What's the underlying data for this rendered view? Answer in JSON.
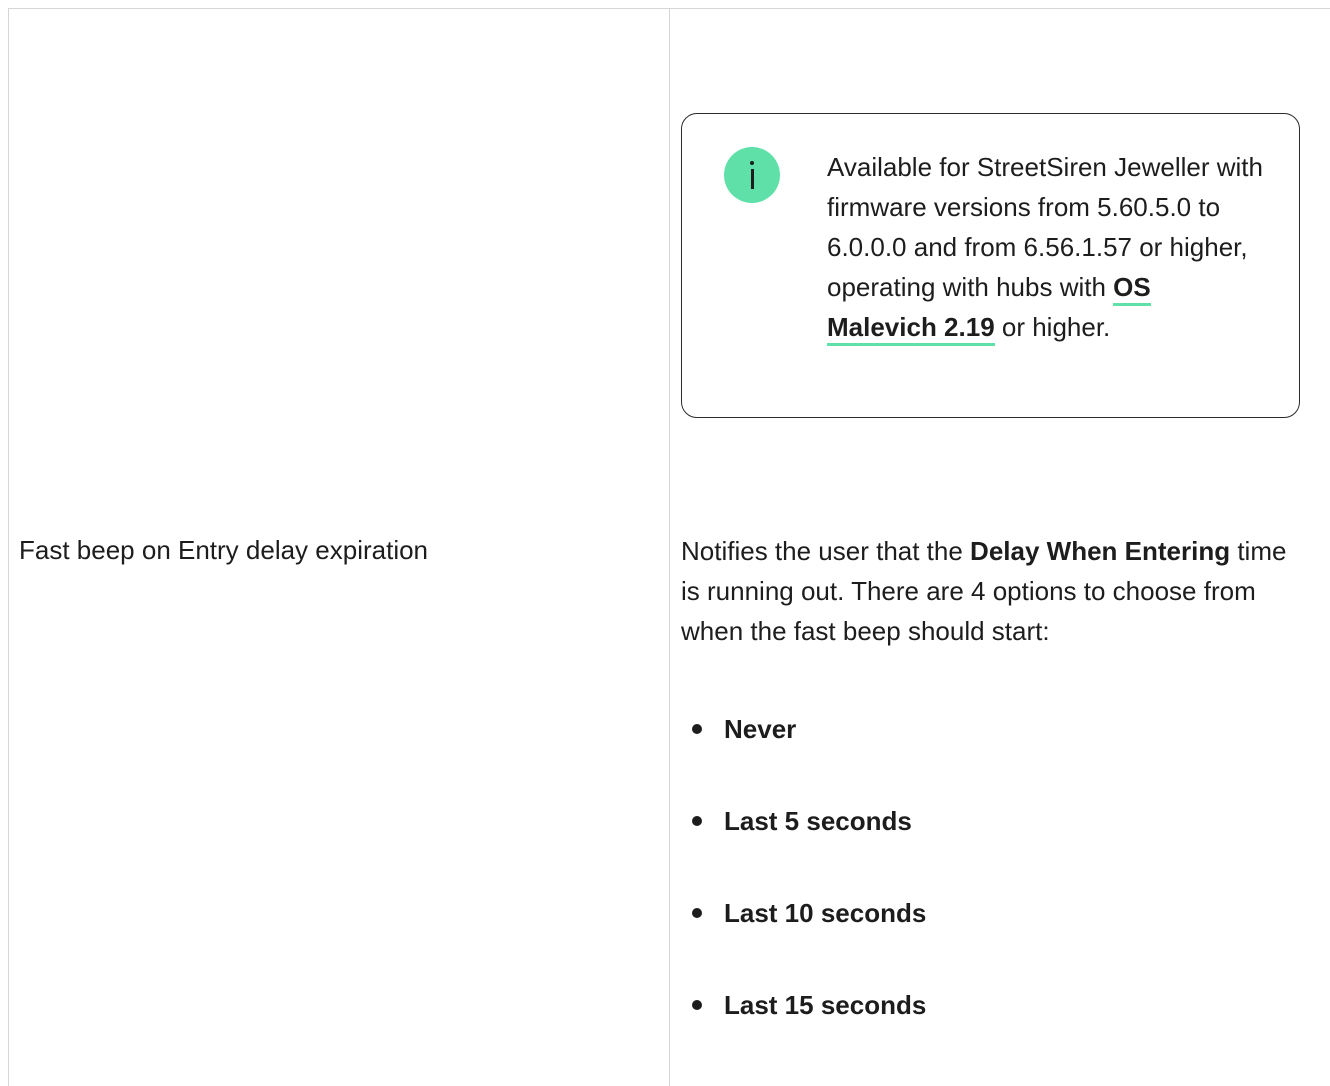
{
  "note": {
    "icon": "info-icon",
    "text_before_link": "Available for StreetSiren Jeweller with firmware versions from 5.60.5.0 to 6.0.0.0 and from 6.56.1.57 or higher, operating with hubs with ",
    "link_label": "OS Malevich 2.19",
    "text_after_link": " or higher."
  },
  "row": {
    "parameter_name": "Fast beep on Entry delay expiration",
    "description": {
      "before_bold": "Notifies the user that the ",
      "bold": "Delay When Entering",
      "after_bold": " time is running out. There are 4 options to choose from when the fast beep should start:"
    },
    "options": [
      "Never",
      "Last 5 seconds",
      "Last 10 seconds",
      "Last 15 seconds"
    ]
  },
  "colors": {
    "accent": "#5ee0a8",
    "text": "#1d1d1d",
    "border": "#d6d6d6"
  }
}
